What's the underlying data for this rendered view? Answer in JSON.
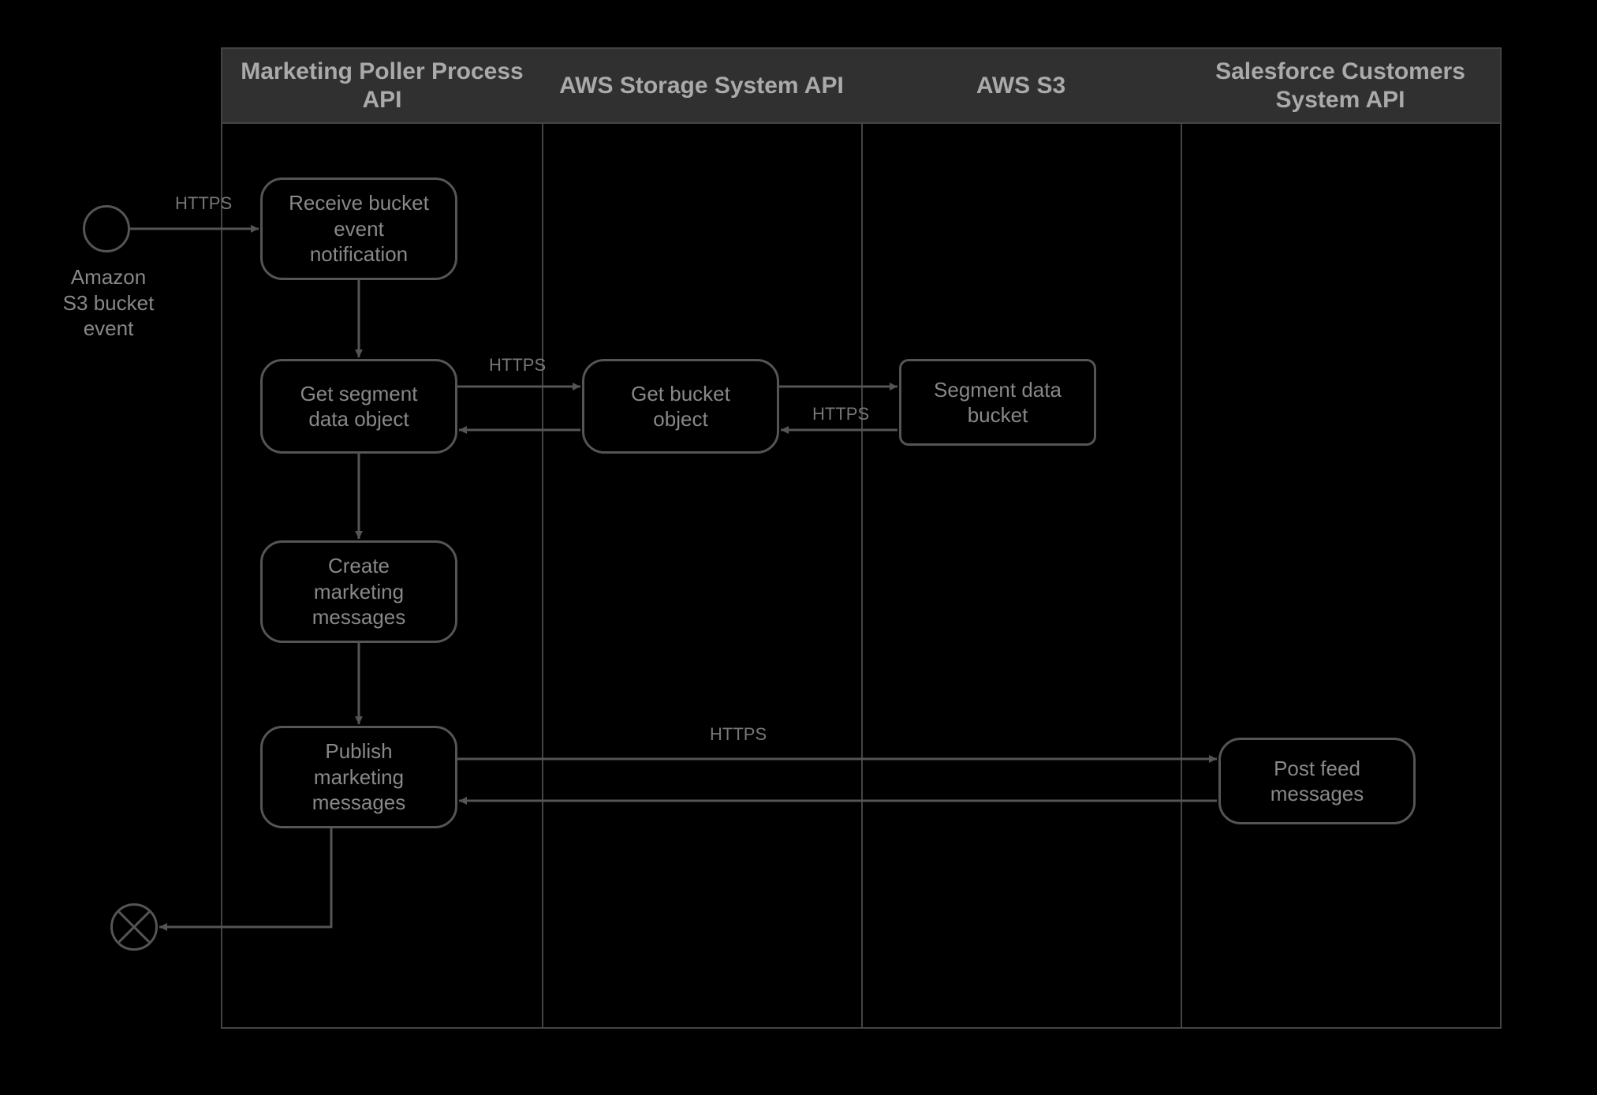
{
  "start": {
    "label": "Amazon\nS3 bucket\nevent"
  },
  "end": {
    "name": "end-event"
  },
  "lanes": [
    {
      "id": "lane-marketing-poller",
      "title": "Marketing Poller Process API"
    },
    {
      "id": "lane-aws-storage",
      "title": "AWS Storage System API"
    },
    {
      "id": "lane-aws-s3",
      "title": "AWS S3"
    },
    {
      "id": "lane-salesforce",
      "title": "Salesforce Customers System API"
    }
  ],
  "nodes": {
    "receive_bucket_event": {
      "label": "Receive bucket\nevent\nnotification",
      "shape": "round"
    },
    "get_segment_data_object": {
      "label": "Get segment\ndata object",
      "shape": "round"
    },
    "create_marketing_msgs": {
      "label": "Create\nmarketing\nmessages",
      "shape": "round"
    },
    "publish_marketing_msgs": {
      "label": "Publish\nmarketing\nmessages",
      "shape": "round"
    },
    "get_bucket_object": {
      "label": "Get bucket\nobject",
      "shape": "round"
    },
    "segment_data_bucket": {
      "label": "Segment data\nbucket",
      "shape": "rect"
    },
    "post_feed_messages": {
      "label": "Post feed\nmessages",
      "shape": "round"
    }
  },
  "edges": {
    "start_to_receive": {
      "label": "HTTPS"
    },
    "receive_to_getsegment": {
      "label": ""
    },
    "getsegment_to_getbucket_fwd": {
      "label": "HTTPS"
    },
    "getbucket_to_getsegment_back": {
      "label": ""
    },
    "getbucket_to_segmentbucket_fwd": {
      "label": ""
    },
    "segmentbucket_to_getbucket_back": {
      "label": "HTTPS"
    },
    "getsegment_to_create": {
      "label": ""
    },
    "create_to_publish": {
      "label": ""
    },
    "publish_to_postfeed_fwd": {
      "label": "HTTPS"
    },
    "postfeed_to_publish_back": {
      "label": ""
    },
    "publish_to_end": {
      "label": ""
    }
  }
}
